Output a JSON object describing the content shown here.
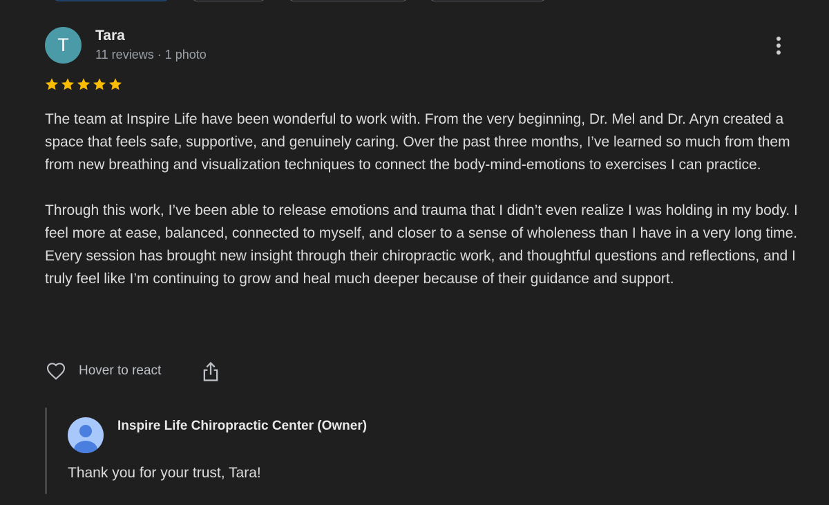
{
  "review": {
    "avatar_letter": "T",
    "avatar_color": "#4a9aa8",
    "reviewer_name": "Tara",
    "reviewer_meta": "11 reviews · 1 photo",
    "rating": 5,
    "star_color": "#fbbc04",
    "paragraphs": [
      "The team at Inspire Life have been wonderful to work with. From the very beginning, Dr. Mel and Dr. Aryn created a space that feels safe, supportive, and genuinely caring. Over the past three months, I’ve learned so much from them from new breathing and visualization techniques to connect the body-mind-emotions to exercises I can practice.",
      "Through this work, I’ve been able to release emotions and trauma that I didn’t even realize I was holding in my body. I feel more at ease, balanced, connected to myself, and closer to a sense of wholeness than I have in a very long time. Every session has brought new insight through their chiropractic work, and thoughtful questions and reflections, and I truly feel like I’m continuing to grow and heal much deeper because of their guidance and support."
    ],
    "actions": {
      "react_label": "Hover to react"
    }
  },
  "owner_reply": {
    "name": "Inspire Life Chiropractic Center (Owner)",
    "text": "Thank you for your trust, Tara!",
    "avatar_color": "#a8c7fa",
    "avatar_icon_color": "#4a7fe0"
  },
  "icons": {
    "more": "more-vert-icon",
    "heart": "heart-outline-icon",
    "share": "share-icon",
    "owner_avatar": "person-icon",
    "star": "star-icon"
  }
}
